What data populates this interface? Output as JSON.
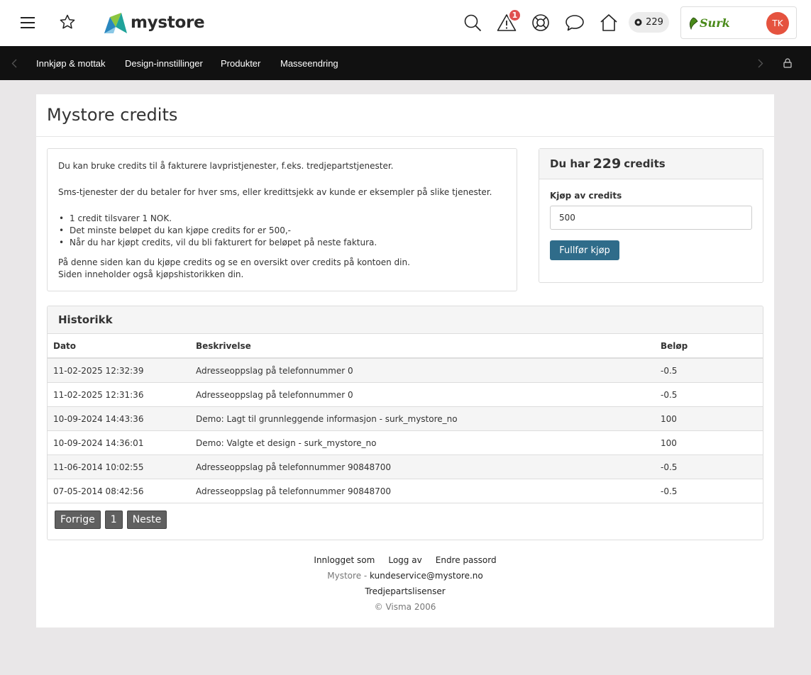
{
  "header": {
    "logo_text": "mystore",
    "notification_count": "1",
    "credits_count": "229",
    "partner_logo_text": "Surk",
    "avatar_initials": "TK"
  },
  "nav": {
    "items": [
      {
        "label": "Innkjøp & mottak"
      },
      {
        "label": "Design-innstillinger"
      },
      {
        "label": "Produkter"
      },
      {
        "label": "Masseendring"
      }
    ]
  },
  "page": {
    "title": "Mystore credits"
  },
  "info": {
    "line1": "Du kan bruke credits til å fakturere lavpristjenester, f.eks. tredjepartstjenester.",
    "line2": "Sms-tjenester der du betaler for hver sms, eller kredittsjekk av kunde er eksempler på slike tjenester.",
    "bullets": [
      "1 credit tilsvarer 1 NOK.",
      "Det minste beløpet du kan kjøpe credits for er 500,-",
      "Når du har kjøpt credits, vil du bli fakturert for beløpet på neste faktura."
    ],
    "line3": "På denne siden kan du kjøpe credits og se en oversikt over credits på kontoen din.",
    "line4": "Siden inneholder også kjøpshistorikken din."
  },
  "buy": {
    "heading_prefix": "Du har",
    "heading_amount": "229",
    "heading_suffix": "credits",
    "label": "Kjøp av credits",
    "input_value": "500",
    "button_label": "Fullfør kjøp"
  },
  "history": {
    "title": "Historikk",
    "columns": [
      "Dato",
      "Beskrivelse",
      "Beløp"
    ],
    "rows": [
      [
        "11-02-2025 12:32:39",
        "Adresseoppslag på telefonnummer 0",
        "-0.5"
      ],
      [
        "11-02-2025 12:31:36",
        "Adresseoppslag på telefonnummer 0",
        "-0.5"
      ],
      [
        "10-09-2024 14:43:36",
        "Demo: Lagt til grunnleggende informasjon - surk_mystore_no",
        "100"
      ],
      [
        "10-09-2024 14:36:01",
        "Demo: Valgte et design - surk_mystore_no",
        "100"
      ],
      [
        "11-06-2014 10:02:55",
        "Adresseoppslag på telefonnummer 90848700",
        "-0.5"
      ],
      [
        "07-05-2014 08:42:56",
        "Adresseoppslag på telefonnummer 90848700",
        "-0.5"
      ]
    ],
    "pager": {
      "prev_label": "Forrige",
      "current_page": "1",
      "next_label": "Neste"
    }
  },
  "footer": {
    "logged_in_label": "Innlogget som",
    "logout_label": "Logg av",
    "change_password_label": "Endre passord",
    "brand_prefix": "Mystore -",
    "support_email": "kundeservice@mystore.no",
    "licenses_label": "Tredjepartslisenser",
    "copyright": "© Visma 2006"
  },
  "colors": {
    "accent_button": "#2f6c8a",
    "badge_red": "#e05050",
    "avatar_bg": "#e5533f",
    "navbar_bg": "#111111"
  },
  "icons": [
    "menu-icon",
    "star-icon",
    "search-icon",
    "alert-icon",
    "help-lifebuoy-icon",
    "chat-icon",
    "home-icon",
    "credits-icon",
    "chevron-left-icon",
    "chevron-right-icon",
    "lock-icon"
  ]
}
